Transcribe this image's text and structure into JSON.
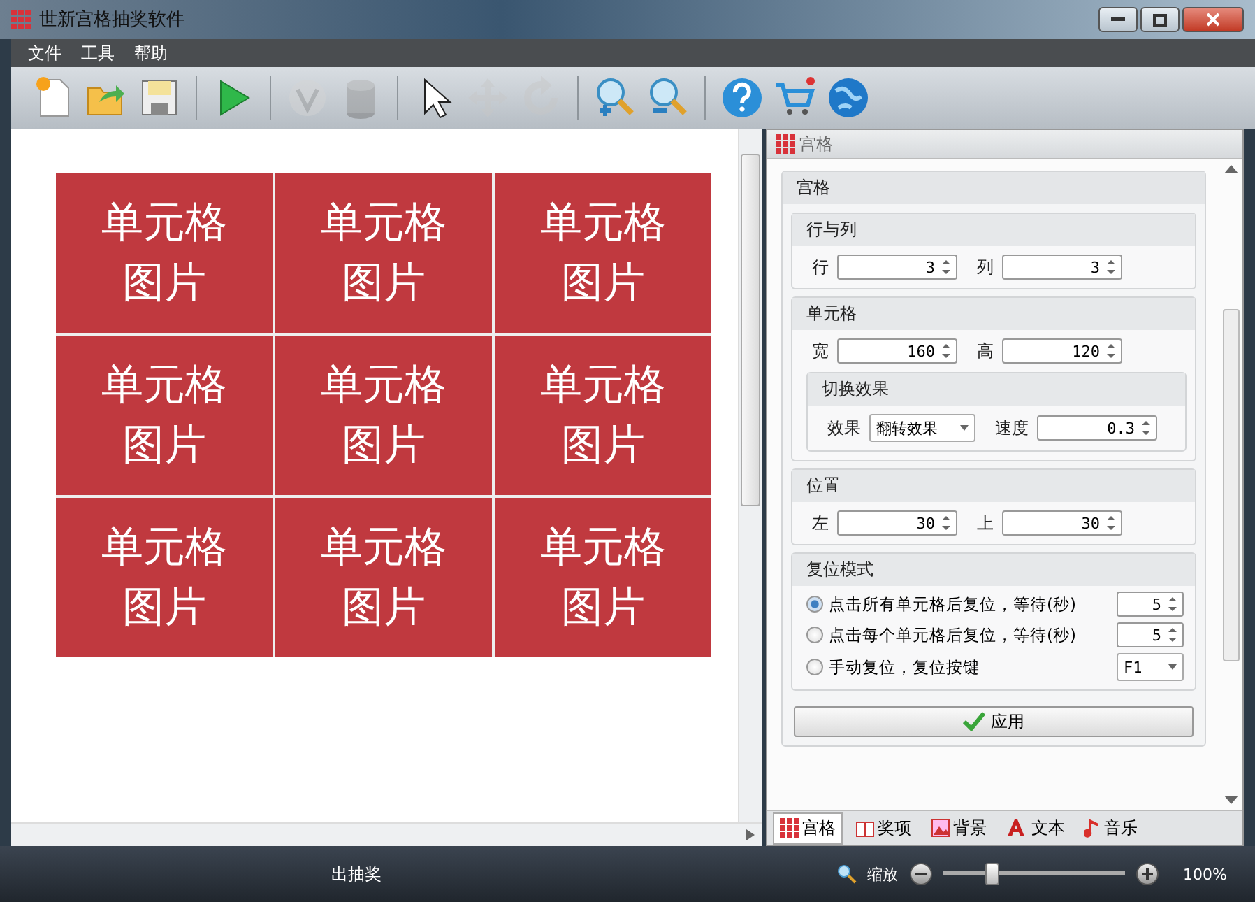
{
  "window": {
    "title": "世新宫格抽奖软件"
  },
  "menu": [
    "文件",
    "工具",
    "帮助"
  ],
  "toolbar": [
    [
      {
        "kind": "new",
        "disabled": false
      },
      {
        "kind": "open",
        "disabled": false
      },
      {
        "kind": "save",
        "disabled": false
      }
    ],
    [
      {
        "kind": "play",
        "disabled": false
      }
    ],
    [
      {
        "kind": "filter",
        "disabled": true
      },
      {
        "kind": "database",
        "disabled": true
      }
    ],
    [
      {
        "kind": "pointer",
        "disabled": false
      },
      {
        "kind": "move",
        "disabled": true
      },
      {
        "kind": "rotate",
        "disabled": true
      }
    ],
    [
      {
        "kind": "zoomin",
        "disabled": false
      },
      {
        "kind": "zoomout",
        "disabled": false
      }
    ],
    [
      {
        "kind": "help",
        "disabled": false
      },
      {
        "kind": "cart",
        "disabled": false
      },
      {
        "kind": "globe",
        "disabled": false
      }
    ]
  ],
  "grid": {
    "rows": [
      [
        {
          "line1": "单元格",
          "line2": "图片"
        },
        {
          "line1": "单元格",
          "line2": "图片"
        },
        {
          "line1": "单元格",
          "line2": "图片"
        }
      ],
      [
        {
          "line1": "单元格",
          "line2": "图片"
        },
        {
          "line1": "单元格",
          "line2": "图片"
        },
        {
          "line1": "单元格",
          "line2": "图片"
        }
      ],
      [
        {
          "line1": "单元格",
          "line2": "图片"
        },
        {
          "line1": "单元格",
          "line2": "图片"
        },
        {
          "line1": "单元格",
          "line2": "图片"
        }
      ]
    ]
  },
  "panel": {
    "title": "宫格",
    "section": "宫格",
    "groups": [
      {
        "title": "行与列",
        "fields": [
          {
            "label": "行",
            "value": "3",
            "kind": "spin"
          },
          {
            "label": "列",
            "value": "3",
            "kind": "spin"
          }
        ]
      },
      {
        "title": "单元格",
        "fields": [
          {
            "label": "宽",
            "value": "160",
            "kind": "spin"
          },
          {
            "label": "高",
            "value": "120",
            "kind": "spin"
          }
        ],
        "subgroup": {
          "title": "切换效果",
          "fields": [
            {
              "label": "效果",
              "value": "翻转效果",
              "kind": "dropdown"
            },
            {
              "label": "速度",
              "value": "0.3",
              "kind": "spin"
            }
          ]
        }
      },
      {
        "title": "位置",
        "fields": [
          {
            "label": "左",
            "value": "30",
            "kind": "spin"
          },
          {
            "label": "上",
            "value": "30",
            "kind": "spin"
          }
        ]
      }
    ],
    "reset": {
      "title": "复位模式",
      "options": [
        {
          "label": "点击所有单元格后复位，等待(秒)",
          "selected": true,
          "value": "5",
          "kind": "spin"
        },
        {
          "label": "点击每个单元格后复位，等待(秒)",
          "selected": false,
          "value": "5",
          "kind": "spin"
        },
        {
          "label": "手动复位，复位按键",
          "selected": false,
          "value": "F1",
          "kind": "dropdown"
        }
      ]
    },
    "apply": "应用",
    "tabs": [
      {
        "label": "宫格",
        "kind": "grid",
        "selected": true
      },
      {
        "label": "奖项",
        "kind": "gift",
        "selected": false
      },
      {
        "label": "背景",
        "kind": "picture",
        "selected": false
      },
      {
        "label": "文本",
        "kind": "text",
        "selected": false
      },
      {
        "label": "音乐",
        "kind": "music",
        "selected": false
      }
    ]
  },
  "status_bar": {
    "message": "出抽奖",
    "zoom_label": "缩放",
    "zoom": {
      "level": 0.27
    },
    "zoom_value": "100%"
  }
}
